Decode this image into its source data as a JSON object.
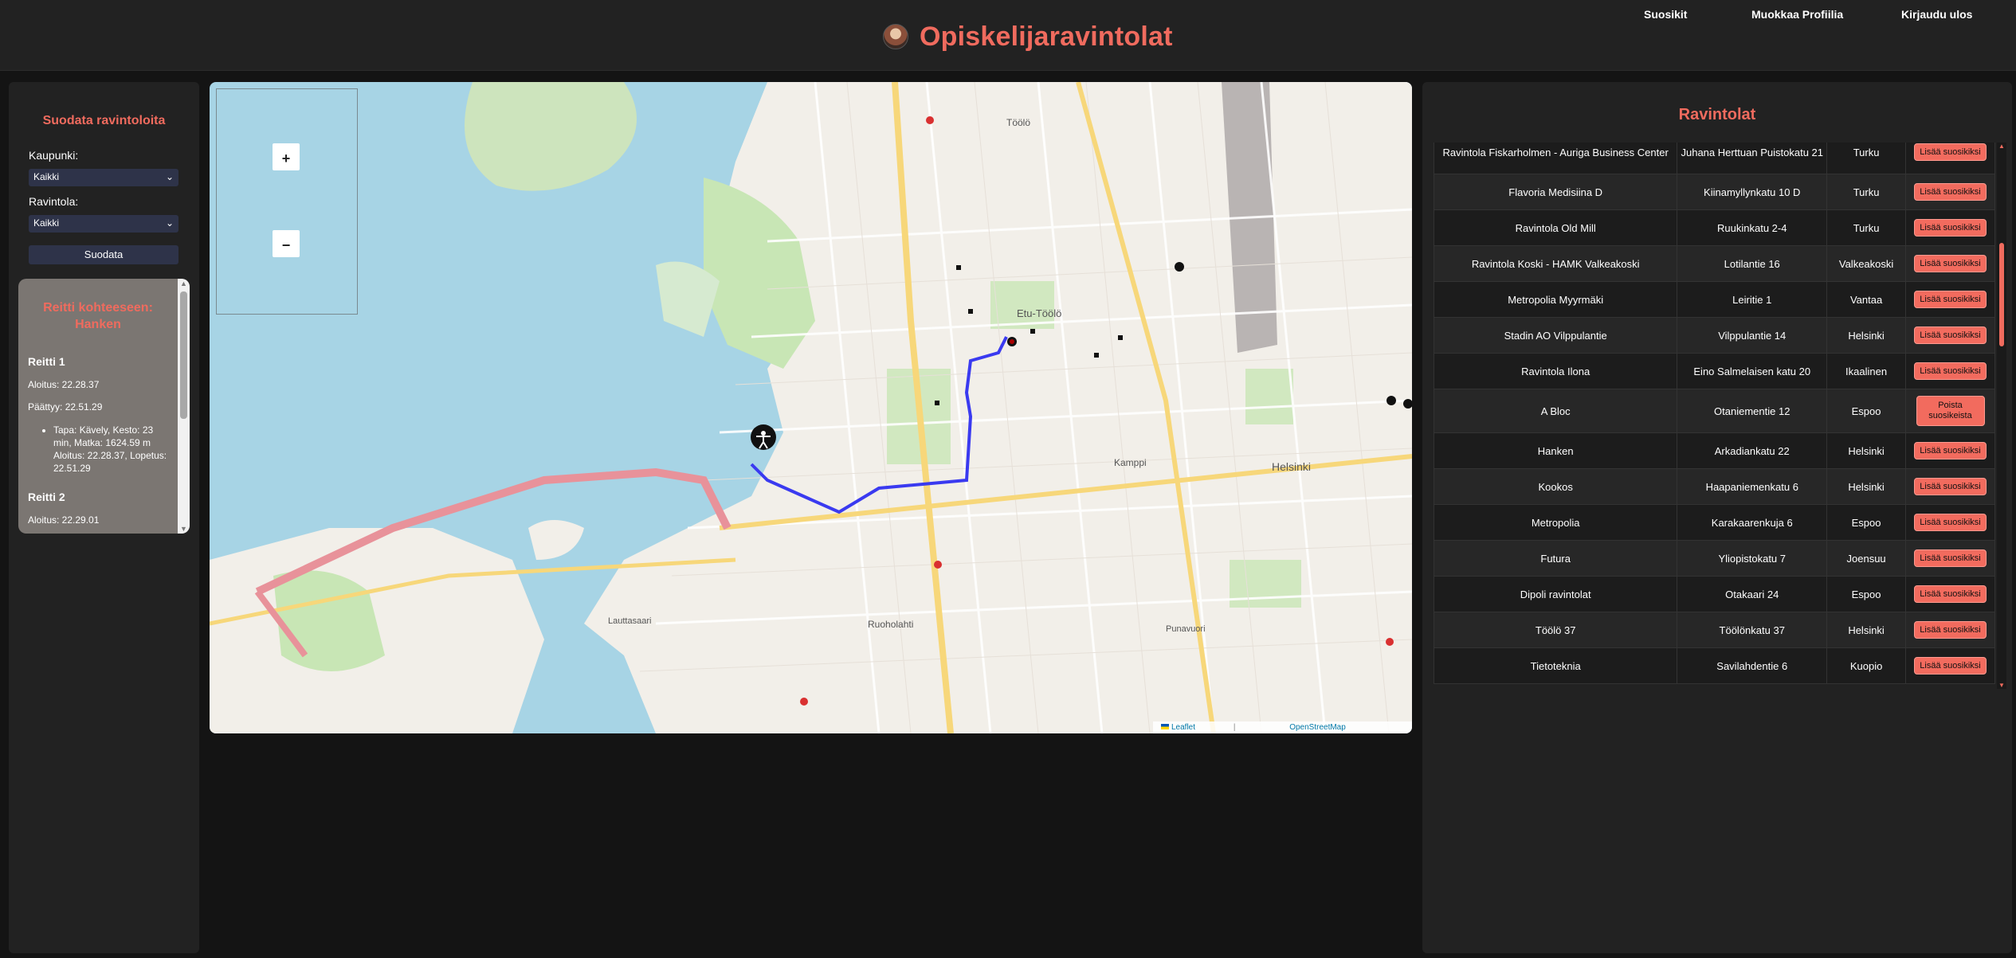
{
  "header": {
    "title": "Opiskelijaravintolat",
    "nav": [
      "Suosikit",
      "Muokkaa Profiilia",
      "Kirjaudu ulos"
    ]
  },
  "filter": {
    "title": "Suodata ravintoloita",
    "city_label": "Kaupunki:",
    "city_value": "Kaikki",
    "restaurant_label": "Ravintola:",
    "restaurant_value": "Kaikki",
    "button": "Suodata"
  },
  "route": {
    "heading": "Reitti kohteeseen: Hanken",
    "routes": [
      {
        "name": "Reitti 1",
        "start": "Aloitus: 22.28.37",
        "end": "Päättyy: 22.51.29",
        "step": "Tapa: Kävely, Kesto: 23 min, Matka: 1624.59 m Aloitus: 22.28.37, Lopetus: 22.51.29"
      },
      {
        "name": "Reitti 2",
        "start": "Aloitus: 22.29.01"
      }
    ]
  },
  "map": {
    "zoom_in": "+",
    "zoom_out": "−",
    "attribution_leaflet": "Leaflet",
    "attribution_sep": "|",
    "attribution_osm": "OpenStreetMap",
    "labels": [
      "Etu-Töölö",
      "Helsinki",
      "Kamppi",
      "Ruoholahti",
      "Lauttasaari",
      "Töölö",
      "Punavuori"
    ],
    "colors": {
      "water": "#a7d4e5",
      "land": "#f2efe9",
      "park": "#c8e6b5",
      "route": "#3a3af0",
      "highway": "#e8929a"
    }
  },
  "restaurants": {
    "title": "Ravintolat",
    "rows": [
      {
        "name": "Ravintola Fiskarholmen - Auriga Business Center",
        "address": "Juhana Herttuan Puistokatu 21",
        "city": "Turku",
        "action": "Lisää suosikiksi"
      },
      {
        "name": "Flavoria Medisiina D",
        "address": "Kiinamyllynkatu 10 D",
        "city": "Turku",
        "action": "Lisää suosikiksi"
      },
      {
        "name": "Ravintola Old Mill",
        "address": "Ruukinkatu 2-4",
        "city": "Turku",
        "action": "Lisää suosikiksi"
      },
      {
        "name": "Ravintola Koski - HAMK Valkeakoski",
        "address": "Lotilantie 16",
        "city": "Valkeakoski",
        "action": "Lisää suosikiksi"
      },
      {
        "name": "Metropolia Myyrmäki",
        "address": "Leiritie 1",
        "city": "Vantaa",
        "action": "Lisää suosikiksi"
      },
      {
        "name": "Stadin AO Vilppulantie",
        "address": "Vilppulantie 14",
        "city": "Helsinki",
        "action": "Lisää suosikiksi"
      },
      {
        "name": "Ravintola Ilona",
        "address": "Eino Salmelaisen katu 20",
        "city": "Ikaalinen",
        "action": "Lisää suosikiksi"
      },
      {
        "name": "A Bloc",
        "address": "Otaniementie 12",
        "city": "Espoo",
        "action": "Poista suosikeista"
      },
      {
        "name": "Hanken",
        "address": "Arkadiankatu 22",
        "city": "Helsinki",
        "action": "Lisää suosikiksi"
      },
      {
        "name": "Kookos",
        "address": "Haapaniemenkatu 6",
        "city": "Helsinki",
        "action": "Lisää suosikiksi"
      },
      {
        "name": "Metropolia",
        "address": "Karakaarenkuja 6",
        "city": "Espoo",
        "action": "Lisää suosikiksi"
      },
      {
        "name": "Futura",
        "address": "Yliopistokatu 7",
        "city": "Joensuu",
        "action": "Lisää suosikiksi"
      },
      {
        "name": "Dipoli ravintolat",
        "address": "Otakaari 24",
        "city": "Espoo",
        "action": "Lisää suosikiksi"
      },
      {
        "name": "Töölö 37",
        "address": "Töölönkatu 37",
        "city": "Helsinki",
        "action": "Lisää suosikiksi"
      },
      {
        "name": "Tietoteknia",
        "address": "Savilahdentie 6",
        "city": "Kuopio",
        "action": "Lisää suosikiksi"
      }
    ]
  }
}
